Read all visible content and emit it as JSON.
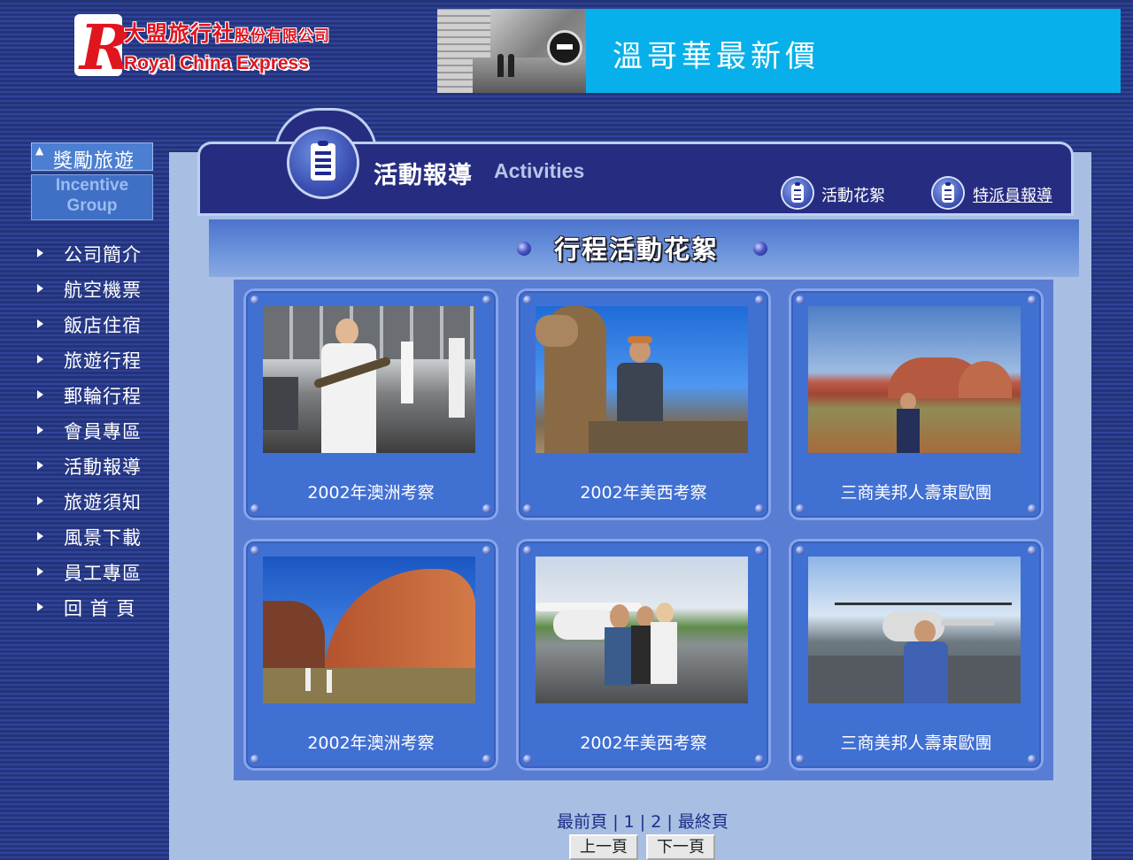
{
  "logo": {
    "mark": "R",
    "chinese_name": "大盟旅行社",
    "chinese_suffix": "股份有限公司",
    "english_name": "Royal China Express"
  },
  "banner": {
    "text": "溫哥華最新價"
  },
  "incentive": {
    "chinese": "獎勵旅遊",
    "english_line1": "Incentive",
    "english_line2": "Group"
  },
  "nav": {
    "items": [
      {
        "label": "公司簡介"
      },
      {
        "label": "航空機票"
      },
      {
        "label": "飯店住宿"
      },
      {
        "label": "旅遊行程"
      },
      {
        "label": "郵輪行程"
      },
      {
        "label": "會員專區"
      },
      {
        "label": "活動報導"
      },
      {
        "label": "旅遊須知"
      },
      {
        "label": "風景下載"
      },
      {
        "label": "員工專區"
      },
      {
        "label": "回 首 頁"
      }
    ]
  },
  "header": {
    "title": "活動報導",
    "title_en": "Activities",
    "links": [
      {
        "label": "活動花絮"
      },
      {
        "label": "特派員報導"
      }
    ]
  },
  "section": {
    "subtitle": "行程活動花絮"
  },
  "cards": [
    {
      "caption": "2002年澳洲考察",
      "scene": "snake-handler-photo"
    },
    {
      "caption": "2002年美西考察",
      "scene": "camel-ride-photo"
    },
    {
      "caption": "三商美邦人壽東歐團",
      "scene": "red-rock-desert-photo"
    },
    {
      "caption": "2002年澳洲考察",
      "scene": "red-rock-dome-photo"
    },
    {
      "caption": "2002年美西考察",
      "scene": "small-plane-group-photo"
    },
    {
      "caption": "三商美邦人壽東歐團",
      "scene": "helicopter-photo"
    }
  ],
  "pagination": {
    "first": "最前頁",
    "sep": "|",
    "pages": [
      "1",
      "2"
    ],
    "last": "最終頁",
    "prev": "上一頁",
    "next": "下一頁"
  },
  "colors": {
    "background_stripe_dark": "#23337a",
    "background_stripe_light": "#31449a",
    "banner_blue": "#07b0ea",
    "header_navy": "#262d80",
    "card_blue": "#4170d3",
    "panel_light": "#a8bfe3",
    "logo_red": "#e0151e"
  }
}
